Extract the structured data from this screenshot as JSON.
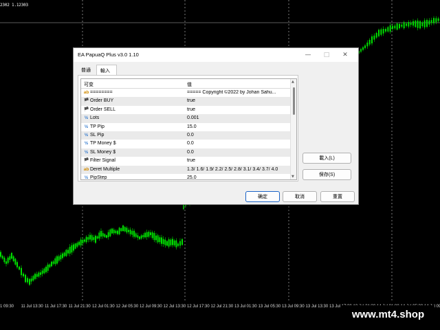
{
  "chart": {
    "price_label": "2302 1.12303",
    "x_axis_labels": [
      "1 09:30",
      "11 Jul 13:30",
      "11 Jul 17:30",
      "11 Jul 21:30",
      "12 Jul 01:30",
      "12 Jul 05:30",
      "12 Jul 09:30",
      "12 Jul 13:30",
      "12 Jul 17:30",
      "12 Jul 21:30",
      "13 Jul 01:30",
      "13 Jul 05:30",
      "13 Jul 09:30",
      "13 Jul 13:30",
      "13 Jul 17:30",
      "13 Jul 21:30",
      "14 Jul 01:30",
      "14 Jul 05:30",
      "14 Jul 09:30"
    ],
    "colors": {
      "background": "#000000",
      "candles": "#00e000",
      "grid": "#d0d0d0"
    }
  },
  "watermark": "www.mt4.shop",
  "dialog": {
    "title": "EA PapuaQ Plus v3.0 1.10",
    "controls": {
      "minimize": "—",
      "maximize": "□",
      "close": "✕"
    },
    "tabs": [
      {
        "label": "普通"
      },
      {
        "label": "輸入"
      }
    ],
    "grid": {
      "col_variable": "可变",
      "col_value": "值",
      "rows": [
        {
          "icon": "ab",
          "icon_type": "string-icon",
          "name": "========",
          "value": "===== Copyright ©2022 by Johan Sahu..."
        },
        {
          "icon": "🏴",
          "icon_type": "bool-icon",
          "name": "Order BUY",
          "value": "true"
        },
        {
          "icon": "🏴",
          "icon_type": "bool-icon",
          "name": "Order SELL",
          "value": "true"
        },
        {
          "icon": "½",
          "icon_type": "number-icon",
          "name": "Lots",
          "value": "0.001"
        },
        {
          "icon": "½",
          "icon_type": "number-icon",
          "name": "TP Pip",
          "value": "15.0"
        },
        {
          "icon": "½",
          "icon_type": "number-icon",
          "name": "SL Pip",
          "value": "0.0"
        },
        {
          "icon": "½",
          "icon_type": "number-icon",
          "name": "TP Money $",
          "value": "0.0"
        },
        {
          "icon": "½",
          "icon_type": "number-icon",
          "name": "SL Money $",
          "value": "0.0"
        },
        {
          "icon": "🏴",
          "icon_type": "bool-icon",
          "name": "Filter Signal",
          "value": "true"
        },
        {
          "icon": "ab",
          "icon_type": "string-icon",
          "name": "Deret Multiple",
          "value": "1.3/ 1.6/ 1.9/ 2.2/ 2.5/ 2.8/ 3.1/ 3.4/ 3.7/ 4.0"
        },
        {
          "icon": "½",
          "icon_type": "number-icon",
          "name": "PipStep",
          "value": "25.0"
        }
      ]
    },
    "buttons": {
      "load": "載入(L)",
      "save": "保存(S)",
      "ok": "确定",
      "cancel": "取消",
      "reset": "重置"
    }
  }
}
